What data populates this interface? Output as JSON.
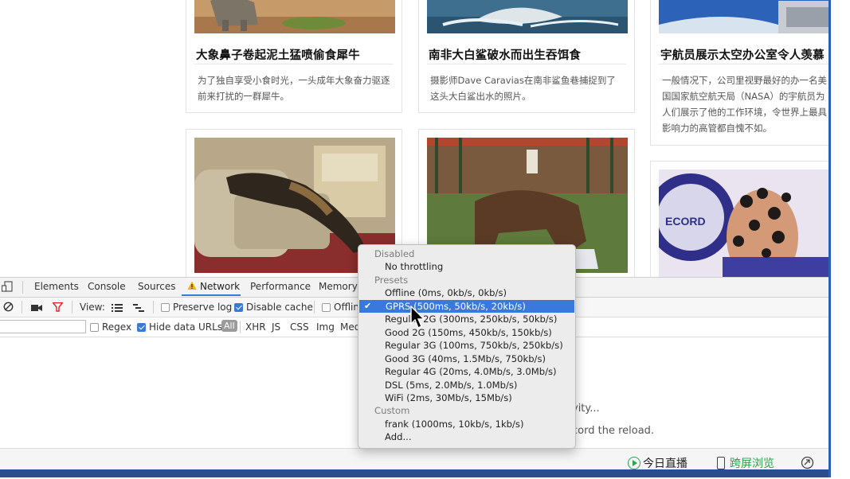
{
  "webpage": {
    "articles": [
      {
        "title": "大象鼻子卷起泥土猛喷偷食犀牛",
        "desc": "为了独自享受小食时光，一头成年大象奋力驱逐前来打扰的一群犀牛。"
      },
      {
        "title": "南非大白鲨破水而出生吞饵食",
        "desc": "摄影师Dave Caravias在南非鲨鱼巷捕捉到了这头大白鲨出水的照片。"
      },
      {
        "title": "宇航员展示太空办公室令人羡慕",
        "desc": "一般情况下，公司里视野最好的办一名美国国家航空航天局（NASA）的宇航员为人们展示了他的工作环境，令世界上最具影响力的高管都自愧不如。"
      }
    ]
  },
  "devtools": {
    "tabs": [
      "Elements",
      "Console",
      "Sources",
      "Network",
      "Performance",
      "Memory"
    ],
    "active_tab": "Network",
    "toolbar": {
      "view_label": "View:",
      "preserve_log": "Preserve log",
      "disable_cache": "Disable cache",
      "offline": "Offlin"
    },
    "filterbar": {
      "regex": "Regex",
      "hide_data_urls": "Hide data URLs",
      "all": "All",
      "types": [
        "XHR",
        "JS",
        "CSS",
        "Img",
        "Med"
      ]
    },
    "hints": {
      "line1_tail": "vity...",
      "line2_tail": "cord the reload."
    },
    "bottom": {
      "live": "今日直播",
      "fullscreen": "跨屏浏览"
    }
  },
  "throttling_menu": {
    "items": [
      {
        "type": "header",
        "label": "Disabled"
      },
      {
        "type": "option",
        "label": "No throttling"
      },
      {
        "type": "header",
        "label": "Presets"
      },
      {
        "type": "option",
        "label": "Offline (0ms, 0kb/s, 0kb/s)"
      },
      {
        "type": "option",
        "label": "GPRS (500ms, 50kb/s, 20kb/s)",
        "selected": true
      },
      {
        "type": "option",
        "label": "Regular 2G (300ms, 250kb/s, 50kb/s)"
      },
      {
        "type": "option",
        "label": "Good 2G (150ms, 450kb/s, 150kb/s)"
      },
      {
        "type": "option",
        "label": "Regular 3G (100ms, 750kb/s, 250kb/s)"
      },
      {
        "type": "option",
        "label": "Good 3G (40ms, 1.5Mb/s, 750kb/s)"
      },
      {
        "type": "option",
        "label": "Regular 4G (20ms, 4.0Mb/s, 3.0Mb/s)"
      },
      {
        "type": "option",
        "label": "DSL (5ms, 2.0Mb/s, 1.0Mb/s)"
      },
      {
        "type": "option",
        "label": "WiFi (2ms, 30Mb/s, 15Mb/s)"
      },
      {
        "type": "header",
        "label": "Custom"
      },
      {
        "type": "option",
        "label": "frank (1000ms, 10kb/s, 1kb/s)"
      },
      {
        "type": "option",
        "label": "Add..."
      }
    ]
  },
  "colors": {
    "accent": "#3a78dc",
    "live_green": "#2aa34a",
    "warning": "#f5b400"
  }
}
